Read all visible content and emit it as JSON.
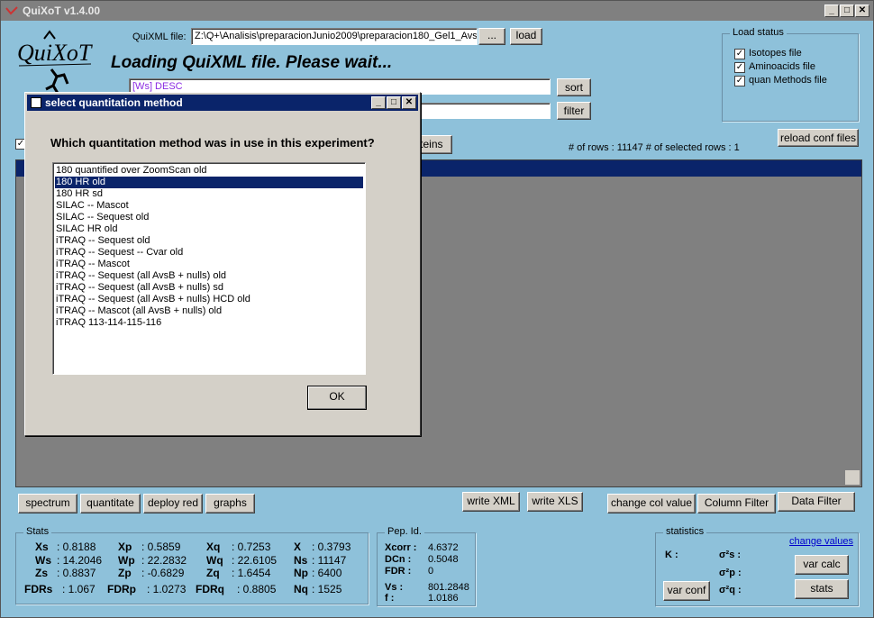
{
  "app": {
    "title": "QuiXoT v1.4.00"
  },
  "header": {
    "quixml_label": "QuiXML file:",
    "quixml_path": "Z:\\Q+\\Analisis\\preparacionJunio2009\\preparacion180_Gel1_Avs",
    "browse_label": "...",
    "load_label": "load",
    "loading_message": "Loading QuiXML file. Please wait...",
    "sort_field_value": "[Ws] DESC",
    "sort_label": "sort",
    "filter_field_value": "",
    "filter_label": "filter",
    "proteins_label": "oteins",
    "rows_info": "# of rows :  11147   # of  selected rows :   1",
    "reload_label": "reload conf files"
  },
  "load_status": {
    "title": "Load status",
    "items": [
      {
        "label": "Isotopes file",
        "checked": true
      },
      {
        "label": "Aminoacids file",
        "checked": true
      },
      {
        "label": "quan Methods file",
        "checked": true
      }
    ]
  },
  "dialog": {
    "title": "select quantitation method",
    "question": "Which quantitation method was in use in this experiment?",
    "options": [
      "180 quantified over ZoomScan old",
      "180 HR old",
      "180 HR sd",
      "SILAC -- Mascot",
      "SILAC -- Sequest old",
      "SILAC HR old",
      "iTRAQ -- Sequest old",
      "iTRAQ -- Sequest -- Cvar old",
      "iTRAQ -- Mascot",
      "iTRAQ -- Sequest (all AvsB + nulls) old",
      "iTRAQ -- Sequest (all AvsB + nulls) sd",
      "iTRAQ -- Sequest (all AvsB + nulls) HCD old",
      "iTRAQ -- Mascot (all AvsB + nulls) old",
      "iTRAQ 113-114-115-116"
    ],
    "selected_index": 1,
    "ok_label": "OK"
  },
  "toolbar": {
    "spectrum": "spectrum",
    "quantitate": "quantitate",
    "deploy_red": "deploy red",
    "graphs": "graphs",
    "write_xml": "write XML",
    "write_xls": "write XLS",
    "change_col_value": "change col value",
    "column_filter": "Column Filter",
    "data_filter": "Data Filter"
  },
  "stats": {
    "title": "Stats",
    "rows": [
      [
        {
          "k": "Xs",
          "v": ": 0.8188"
        },
        {
          "k": "Xp",
          "v": ": 0.5859"
        },
        {
          "k": "Xq",
          "v": ": 0.7253"
        },
        {
          "k": "X",
          "v": ": 0.3793"
        }
      ],
      [
        {
          "k": "Ws",
          "v": ": 14.2046"
        },
        {
          "k": "Wp",
          "v": ": 22.2832"
        },
        {
          "k": "Wq",
          "v": ": 22.6105"
        },
        {
          "k": "Ns",
          "v": ": 11147"
        }
      ],
      [
        {
          "k": "Zs",
          "v": ": 0.8837"
        },
        {
          "k": "Zp",
          "v": ": -0.6829"
        },
        {
          "k": "Zq",
          "v": ": 1.6454"
        },
        {
          "k": "Np",
          "v": ": 6400"
        }
      ],
      [
        {
          "k": "FDRs",
          "v": ": 1.067"
        },
        {
          "k": "FDRp",
          "v": ": 1.0273"
        },
        {
          "k": "FDRq",
          "v": ": 0.8805"
        },
        {
          "k": "Nq",
          "v": ": 1525"
        }
      ]
    ]
  },
  "pep_id": {
    "title": "Pep. Id.",
    "xcorr_k": "Xcorr :",
    "xcorr_v": "4.6372",
    "dcn_k": "DCn :",
    "dcn_v": "0.5048",
    "fdr_k": "FDR :",
    "fdr_v": "0",
    "vs_k": "Vs :",
    "vs_v": "801.2848",
    "f_k": "f :",
    "f_v": "1.0186"
  },
  "statistics": {
    "title": "statistics",
    "change_values": "change values",
    "k_label": "K :",
    "s2s": "σ²s :",
    "s2p": "σ²p :",
    "s2q": "σ²q :",
    "var_calc": "var calc",
    "var_conf": "var conf",
    "stats_btn": "stats"
  }
}
